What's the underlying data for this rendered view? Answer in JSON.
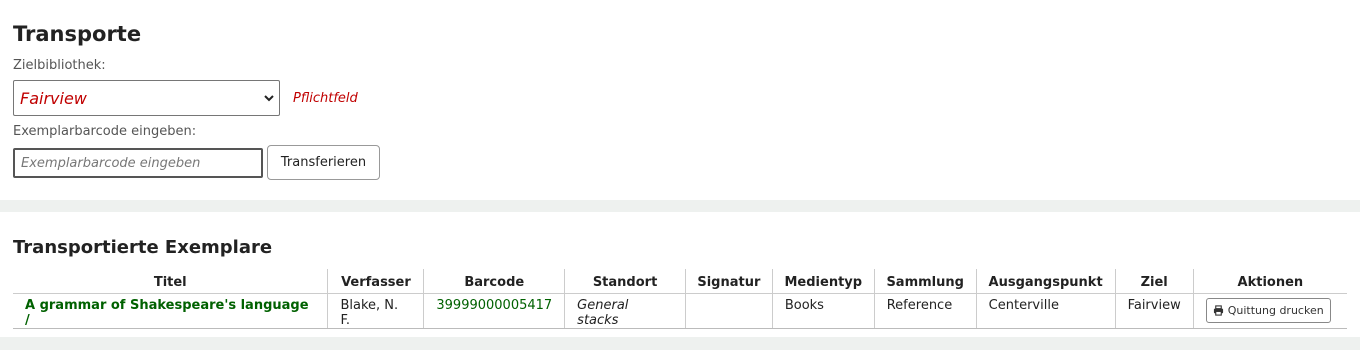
{
  "page": {
    "title": "Transporte",
    "library_label": "Zielbibliothek:",
    "library_selected": "Fairview",
    "required_text": "Pflichtfeld",
    "barcode_label": "Exemplarbarcode eingeben:",
    "barcode_placeholder": "Exemplarbarcode eingeben",
    "transfer_button": "Transferieren"
  },
  "transfers": {
    "heading": "Transportierte Exemplare",
    "columns": [
      "Titel",
      "Verfasser",
      "Barcode",
      "Standort",
      "Signatur",
      "Medientyp",
      "Sammlung",
      "Ausgangspunkt",
      "Ziel",
      "Aktionen"
    ],
    "rows": [
      {
        "title": "A grammar of Shakespeare's language /",
        "author": "Blake, N. F.",
        "barcode": "39999000005417",
        "location": "General stacks",
        "callnumber": "",
        "itemtype": "Books",
        "collection": "Reference",
        "from": "Centerville",
        "to": "Fairview",
        "action_label": "Quittung drucken"
      }
    ]
  },
  "colors": {
    "link": "#006100",
    "required": "#c00000",
    "separator": "#eef1ef"
  },
  "icons": {
    "print": "printer-icon",
    "select": "chevron-down-icon"
  }
}
